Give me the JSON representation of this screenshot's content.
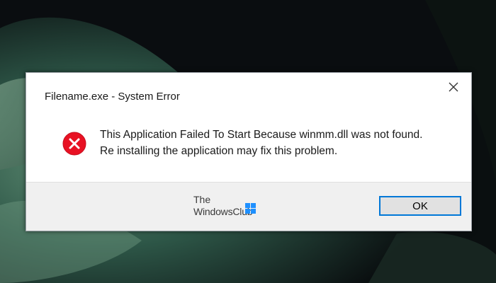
{
  "dialog": {
    "title": "Filename.exe - System Error",
    "message": "This Application Failed To Start Because winmm.dll was not found. Re installing the application may fix this problem.",
    "ok_label": "OK",
    "icon": "error-icon",
    "close_icon": "close-icon"
  },
  "watermark": {
    "line1": "The",
    "line2": "WindowsClub"
  },
  "colors": {
    "error_red": "#e81123",
    "button_focus": "#0078d7",
    "footer_bg": "#f0f0f0",
    "logo_blue": "#1e90ff"
  }
}
